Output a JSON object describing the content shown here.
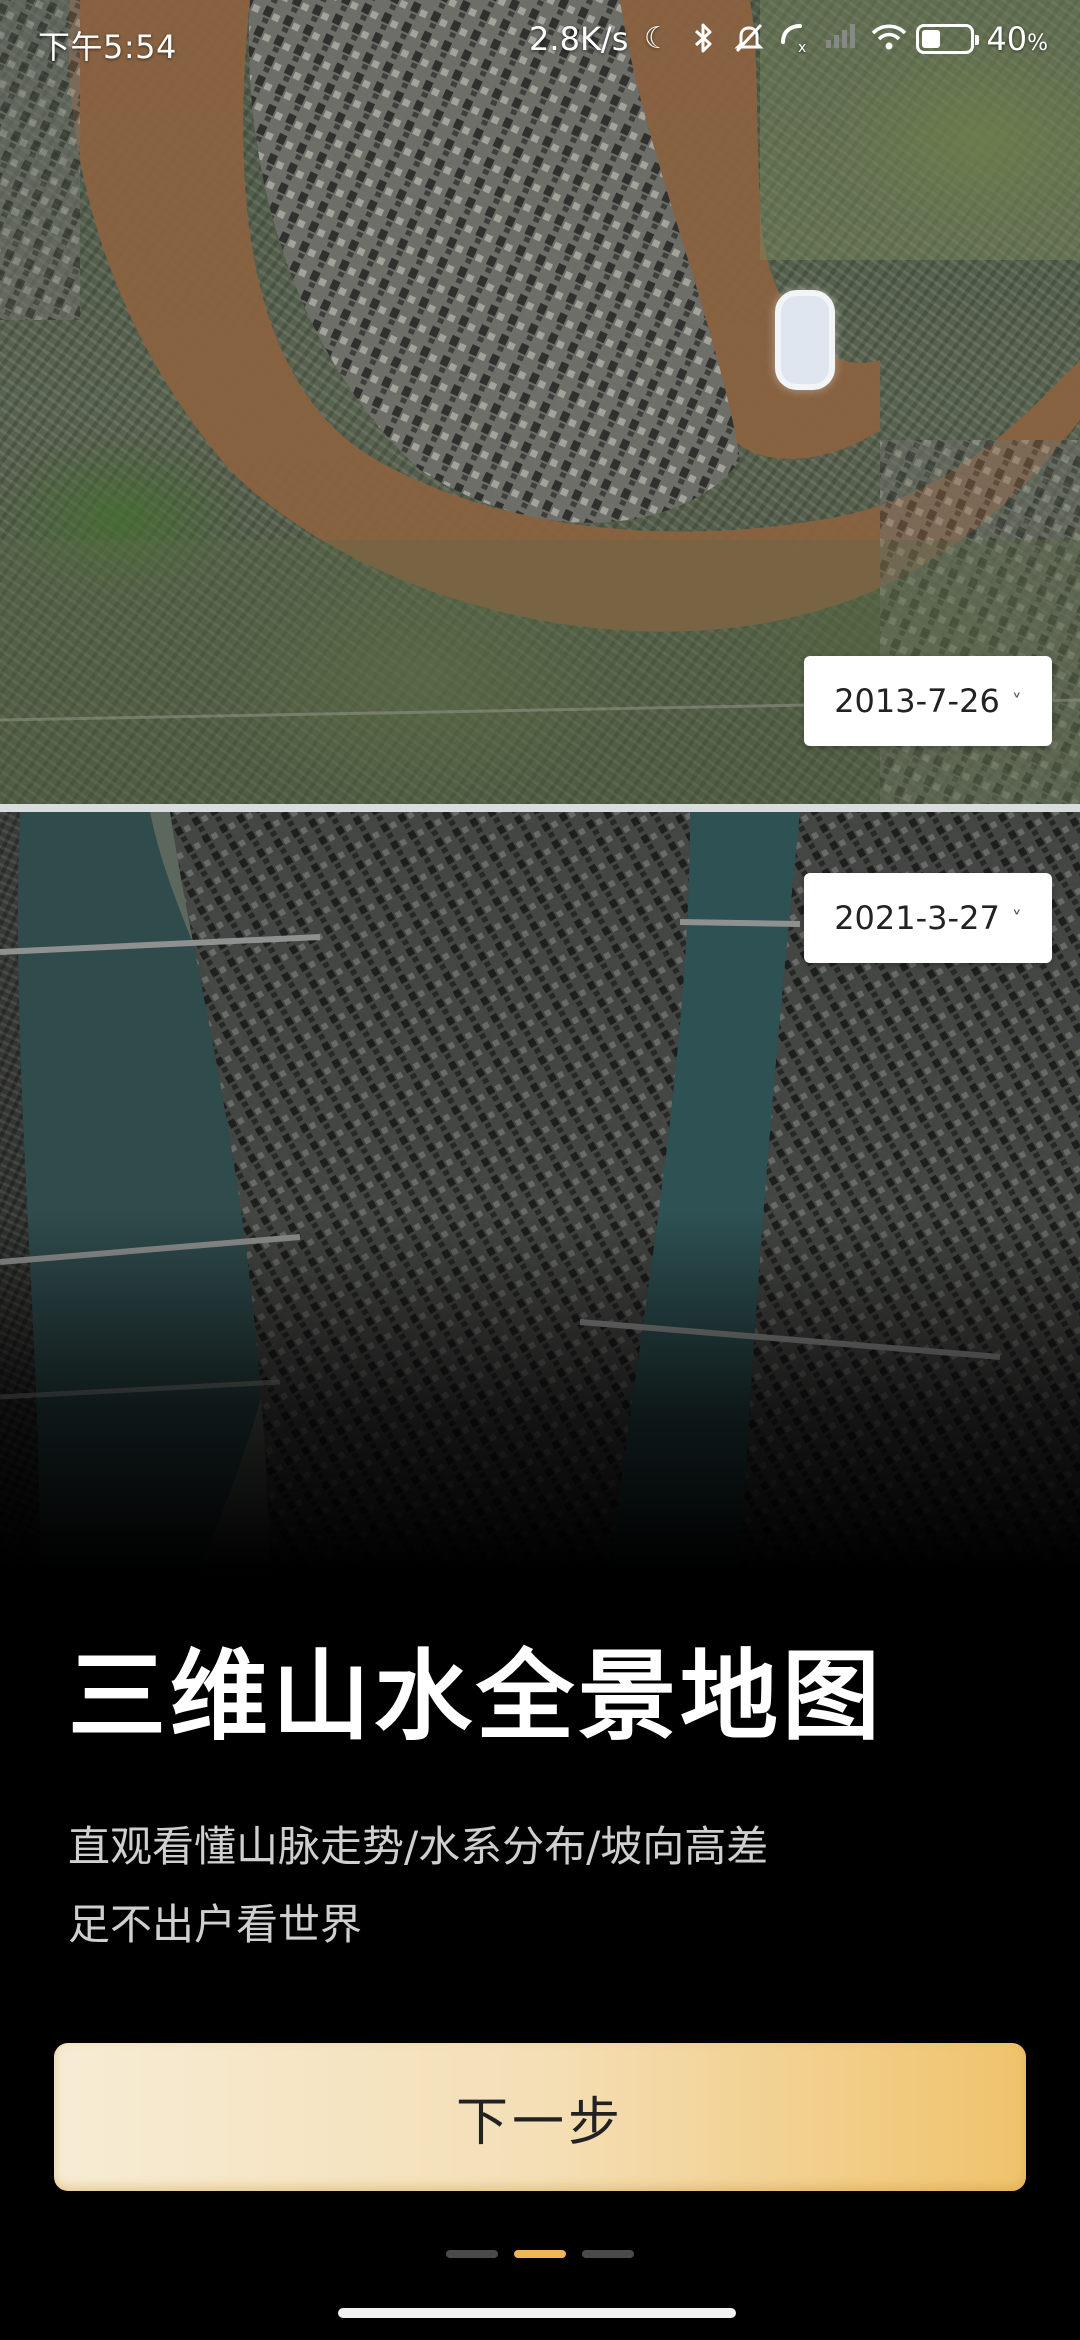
{
  "status_bar": {
    "time": "下午5:54",
    "network_speed": "2.8K/s",
    "icons": [
      "moon-icon",
      "bluetooth-icon",
      "mute-bell-icon",
      "call-icon",
      "signal-icon",
      "wifi-icon"
    ],
    "battery_level": 0.4,
    "battery_text": "40",
    "battery_unit": "%"
  },
  "compare": {
    "top_date": "2013-7-26",
    "bottom_date": "2021-3-27"
  },
  "content": {
    "title": "三维山水全景地图",
    "subtitle_line1": "直观看懂山脉走势/水系分布/坡向高差",
    "subtitle_line2": "足不出户看世界"
  },
  "actions": {
    "next_label": "下一步"
  },
  "pager": {
    "total": 3,
    "current": 2
  },
  "colors": {
    "accent": "#f0b556",
    "button_start": "#f7ecd4",
    "button_end": "#f0c36c",
    "background": "#000000"
  }
}
